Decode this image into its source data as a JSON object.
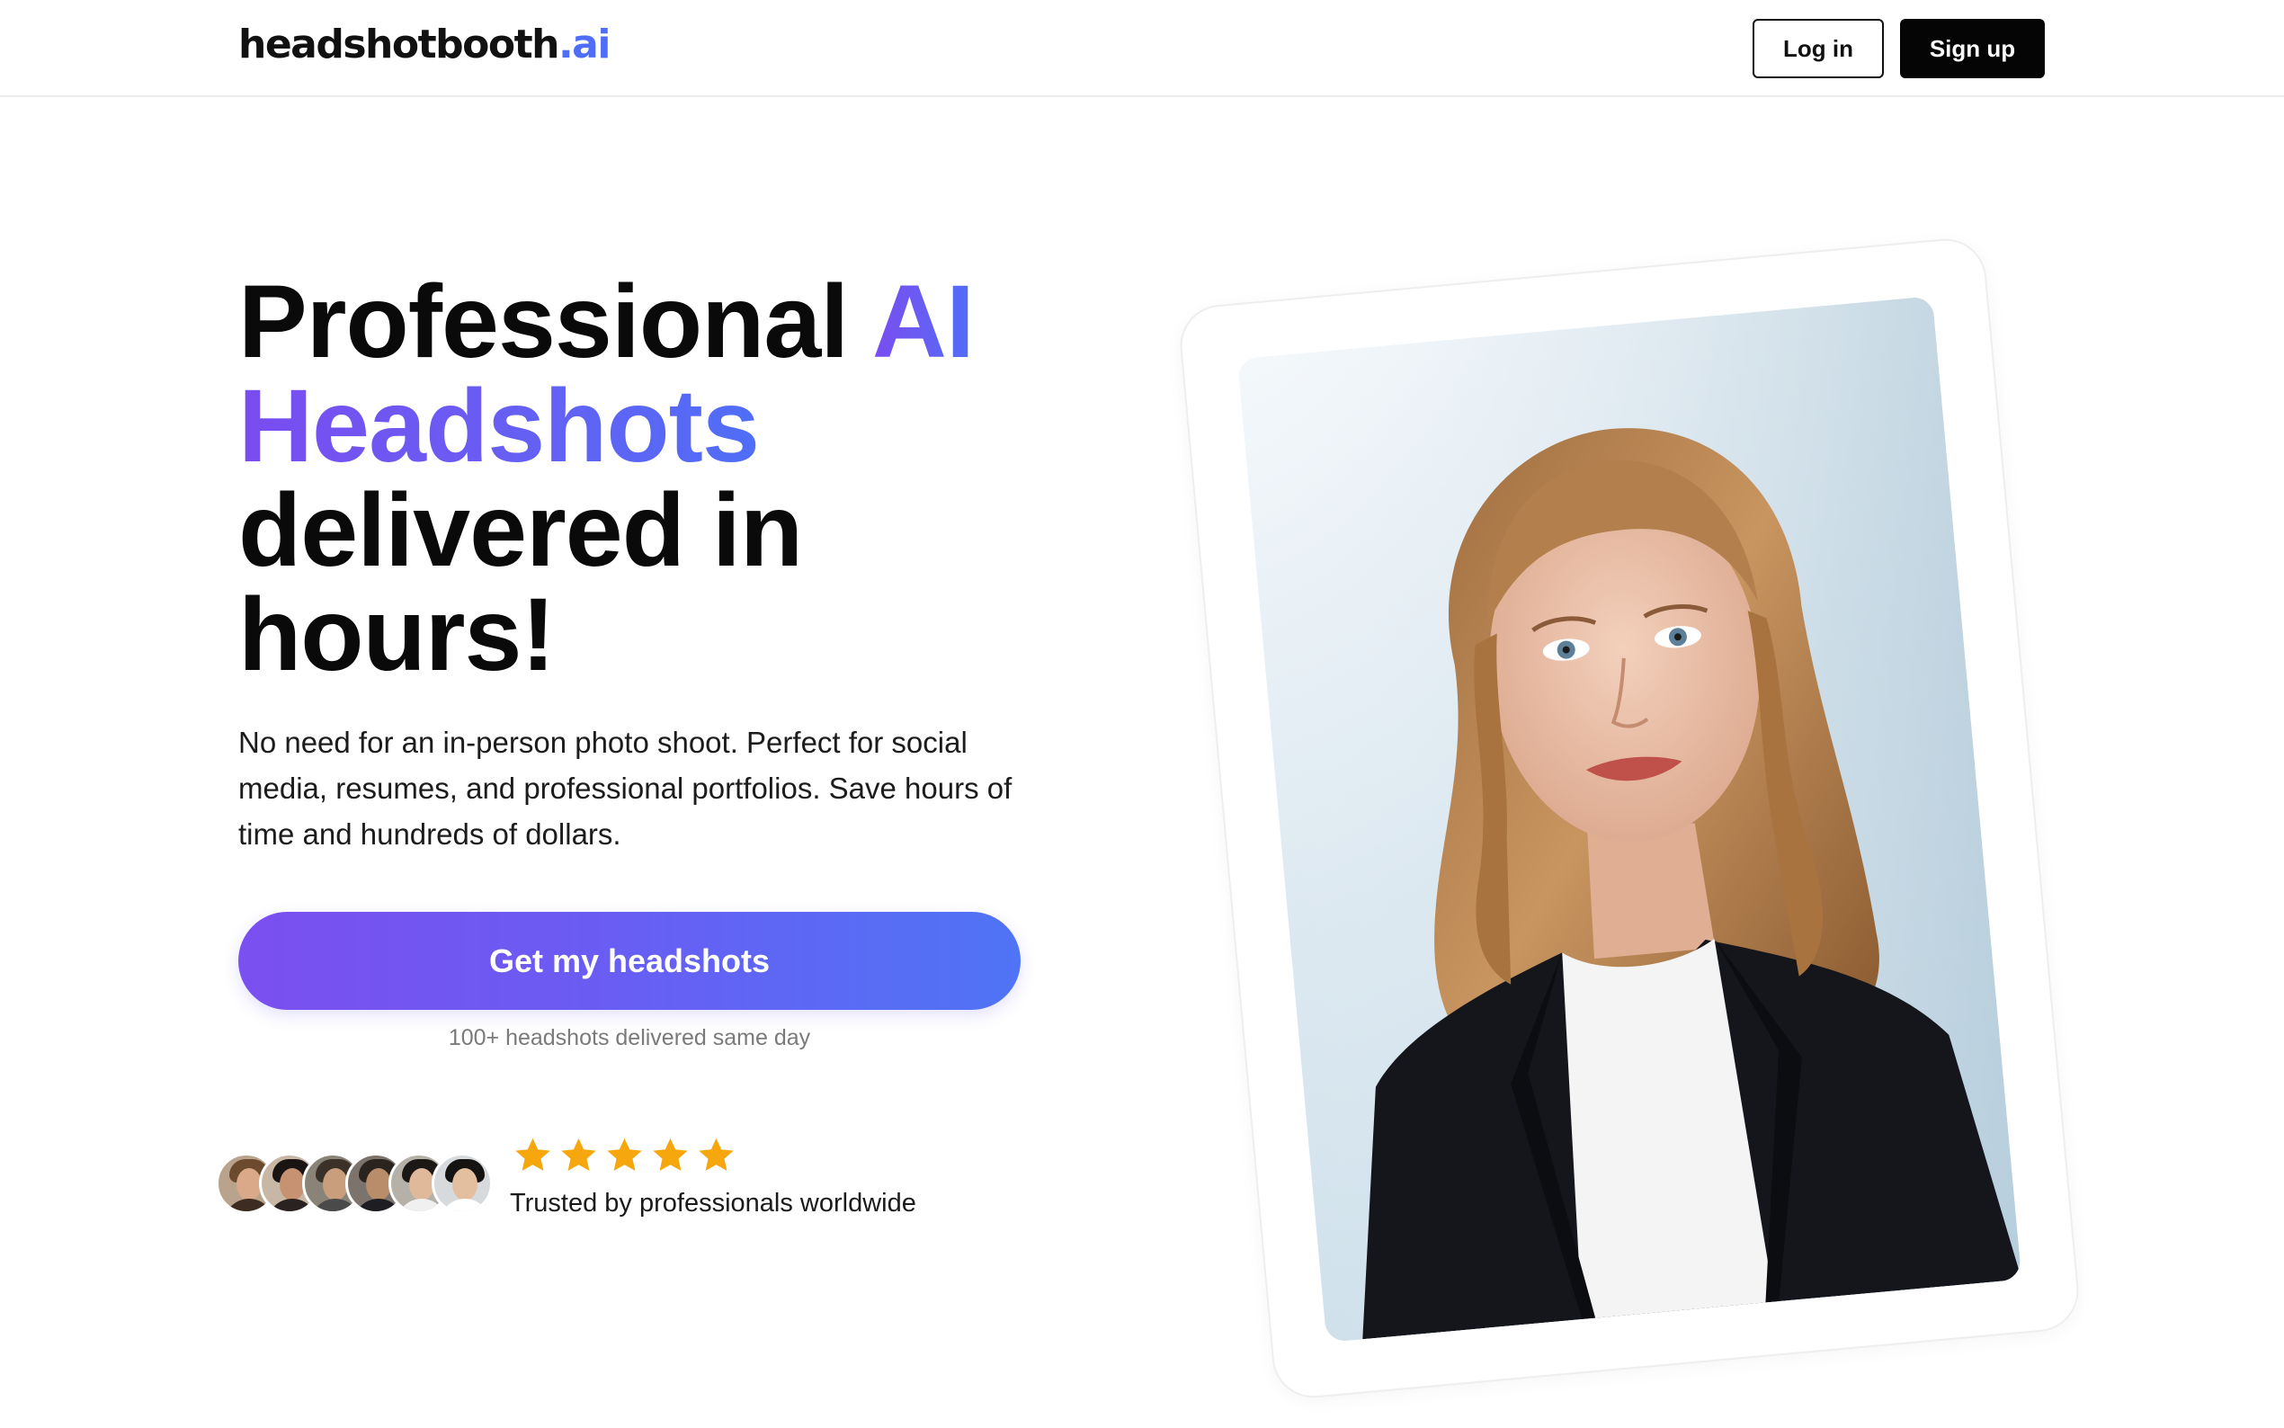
{
  "header": {
    "logo_main": "headshotbooth",
    "logo_accent": ".ai",
    "login_label": "Log in",
    "signup_label": "Sign up"
  },
  "hero": {
    "headline_part1": "Professional ",
    "headline_accent_1": "AI",
    "headline_accent_2": "Headshots",
    "headline_line3": "delivered in",
    "headline_line4": "hours!",
    "subtext": "No need for an in-person photo shoot. Perfect for social media, resumes, and professional portfolios. Save hours of time and hundreds of dollars.",
    "cta_label": "Get my headshots",
    "cta_note": "100+ headshots delivered same day"
  },
  "social_proof": {
    "avatar_count": 6,
    "rating_stars": 5,
    "trust_text": "Trusted by professionals worldwide"
  },
  "colors": {
    "accent_purple": "#7a4cf0",
    "accent_blue": "#4f6ef7",
    "star": "#f5a70d",
    "primary_button": "#050505"
  },
  "icons": {
    "star": "star-icon"
  }
}
